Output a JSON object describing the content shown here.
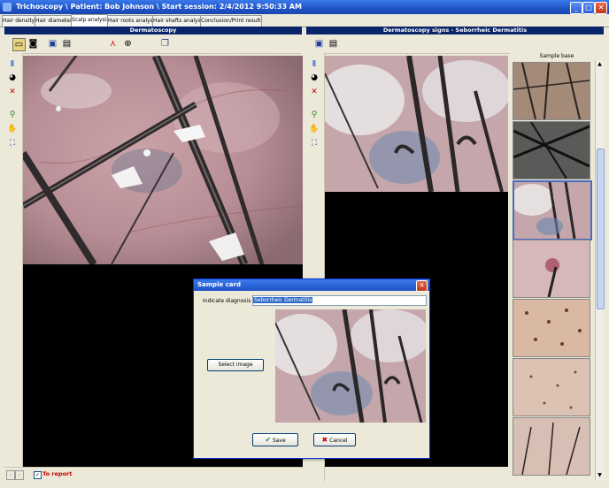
{
  "window": {
    "title": "Trichoscopy  \\ Patient: Bob Johnson \\ Start session: 2/4/2012 9:50:33 AM",
    "controls": [
      "_",
      "□",
      "✕"
    ]
  },
  "tabs": [
    {
      "label": "Hair density",
      "active": false
    },
    {
      "label": "Hair diameter",
      "active": false
    },
    {
      "label": "Scalp analysis",
      "active": true
    },
    {
      "label": "Hair roots analysis",
      "active": false
    },
    {
      "label": "Hair shafts analysis",
      "active": false
    },
    {
      "label": "Conclusion/Print results",
      "active": false
    }
  ],
  "left_panel": {
    "header": "Dermatoscopy",
    "to_report_label": "To report",
    "to_report_checked": true
  },
  "right_panel": {
    "header": "Dermatoscopy signs - Seborrheic Dermatitis",
    "sample_base_header": "Sample base"
  },
  "dialog": {
    "title": "Sample card",
    "diagnosis_label": "Indicate diagnosis",
    "diagnosis_value": "Seborrheic Dermatitis",
    "select_image_label": "Select image",
    "save_label": "Save",
    "cancel_label": "Cancel"
  },
  "colors": {
    "title_bar": "#2563d9",
    "panel_header": "#0a246a",
    "to_report_text": "#c00000",
    "window_bg": "#ece9d8"
  }
}
